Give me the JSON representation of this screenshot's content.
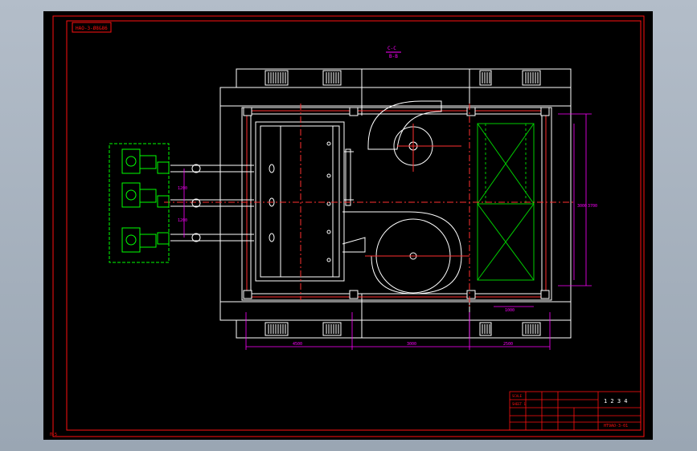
{
  "drawing": {
    "stamp_text": "HAO-3-Ø8&86",
    "section_top": "C-C",
    "section_bottom": "B-B",
    "corner_mark": "Π-5",
    "dimensions": {
      "bottom_left": "4500",
      "bottom_mid": "3000",
      "bottom_right": "2500",
      "right_inner": "3000",
      "right_outer": "3700",
      "left_upper": "1200",
      "left_lower": "1200",
      "small_right": "1000"
    },
    "title_block": {
      "drawing_no": "HT9AO-3-01",
      "logo_text": "1 2 3 4",
      "small_lines": [
        "SCALE",
        "SHEET 1"
      ]
    }
  },
  "colors": {
    "frame": "#ff1010",
    "linework": "#ffffff",
    "dimension": "#ff00ff",
    "center": "#ff3030",
    "motor": "#00ff00",
    "screen_bg": "#000000"
  }
}
